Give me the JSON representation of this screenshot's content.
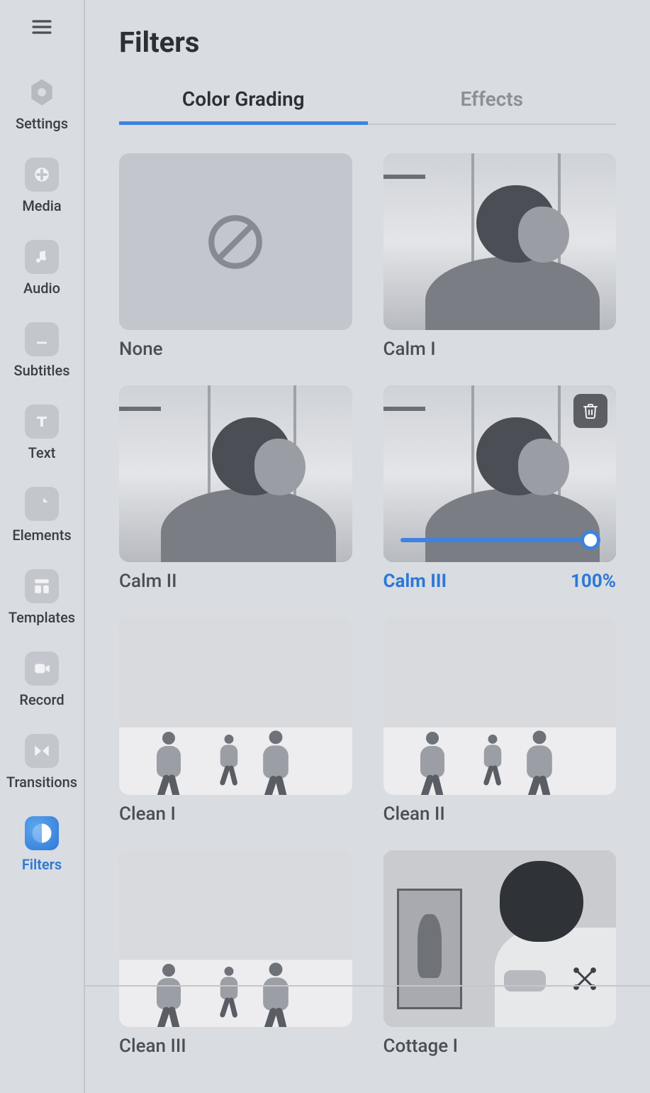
{
  "sidebar": {
    "items": [
      {
        "id": "settings",
        "label": "Settings"
      },
      {
        "id": "media",
        "label": "Media"
      },
      {
        "id": "audio",
        "label": "Audio"
      },
      {
        "id": "subtitles",
        "label": "Subtitles"
      },
      {
        "id": "text",
        "label": "Text"
      },
      {
        "id": "elements",
        "label": "Elements"
      },
      {
        "id": "templates",
        "label": "Templates"
      },
      {
        "id": "record",
        "label": "Record"
      },
      {
        "id": "transitions",
        "label": "Transitions"
      },
      {
        "id": "filters",
        "label": "Filters",
        "active": true
      }
    ]
  },
  "page": {
    "title": "Filters"
  },
  "tabs": [
    {
      "id": "color-grading",
      "label": "Color Grading",
      "active": true
    },
    {
      "id": "effects",
      "label": "Effects"
    }
  ],
  "filters": [
    {
      "id": "none",
      "label": "None",
      "kind": "none"
    },
    {
      "id": "calm-1",
      "label": "Calm I",
      "kind": "window"
    },
    {
      "id": "calm-2",
      "label": "Calm II",
      "kind": "window"
    },
    {
      "id": "calm-3",
      "label": "Calm III",
      "kind": "window",
      "selected": true,
      "intensity_pct": 100,
      "intensity_label": "100%"
    },
    {
      "id": "clean-1",
      "label": "Clean I",
      "kind": "runners"
    },
    {
      "id": "clean-2",
      "label": "Clean II",
      "kind": "runners"
    },
    {
      "id": "clean-3",
      "label": "Clean III",
      "kind": "runners"
    },
    {
      "id": "cottage-1",
      "label": "Cottage I",
      "kind": "painter"
    }
  ]
}
